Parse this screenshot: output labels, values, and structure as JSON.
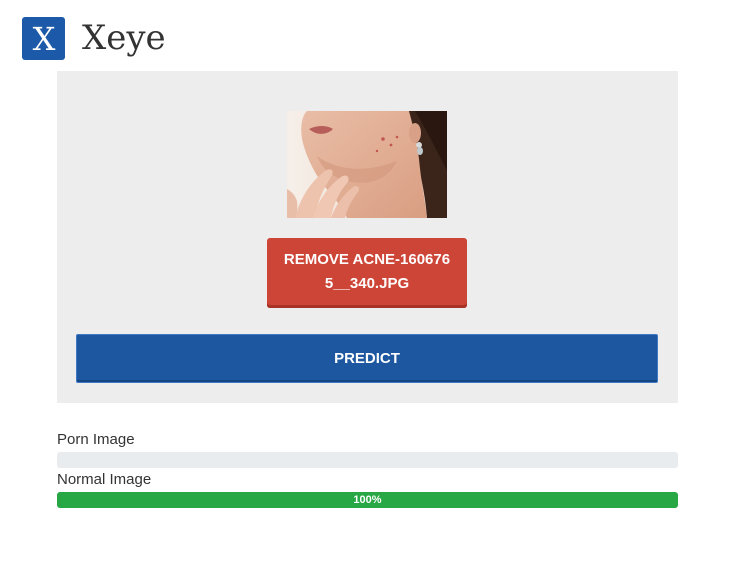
{
  "brand": {
    "logo_letter": "X",
    "name": "Xeye"
  },
  "upload": {
    "preview_icon": "uploaded-photo-thumbnail",
    "remove_label": "REMOVE ACNE-1606765__340.JPG"
  },
  "predict": {
    "label": "PREDICT"
  },
  "results": [
    {
      "label": "Porn Image",
      "percent": 0,
      "percent_text": ""
    },
    {
      "label": "Normal Image",
      "percent": 100,
      "percent_text": "100%"
    }
  ],
  "colors": {
    "brand_blue": "#1c5aa9",
    "remove_red": "#cd4536",
    "predict_blue": "#1c57a0",
    "progress_green": "#28a745",
    "panel_gray": "#ededed"
  }
}
